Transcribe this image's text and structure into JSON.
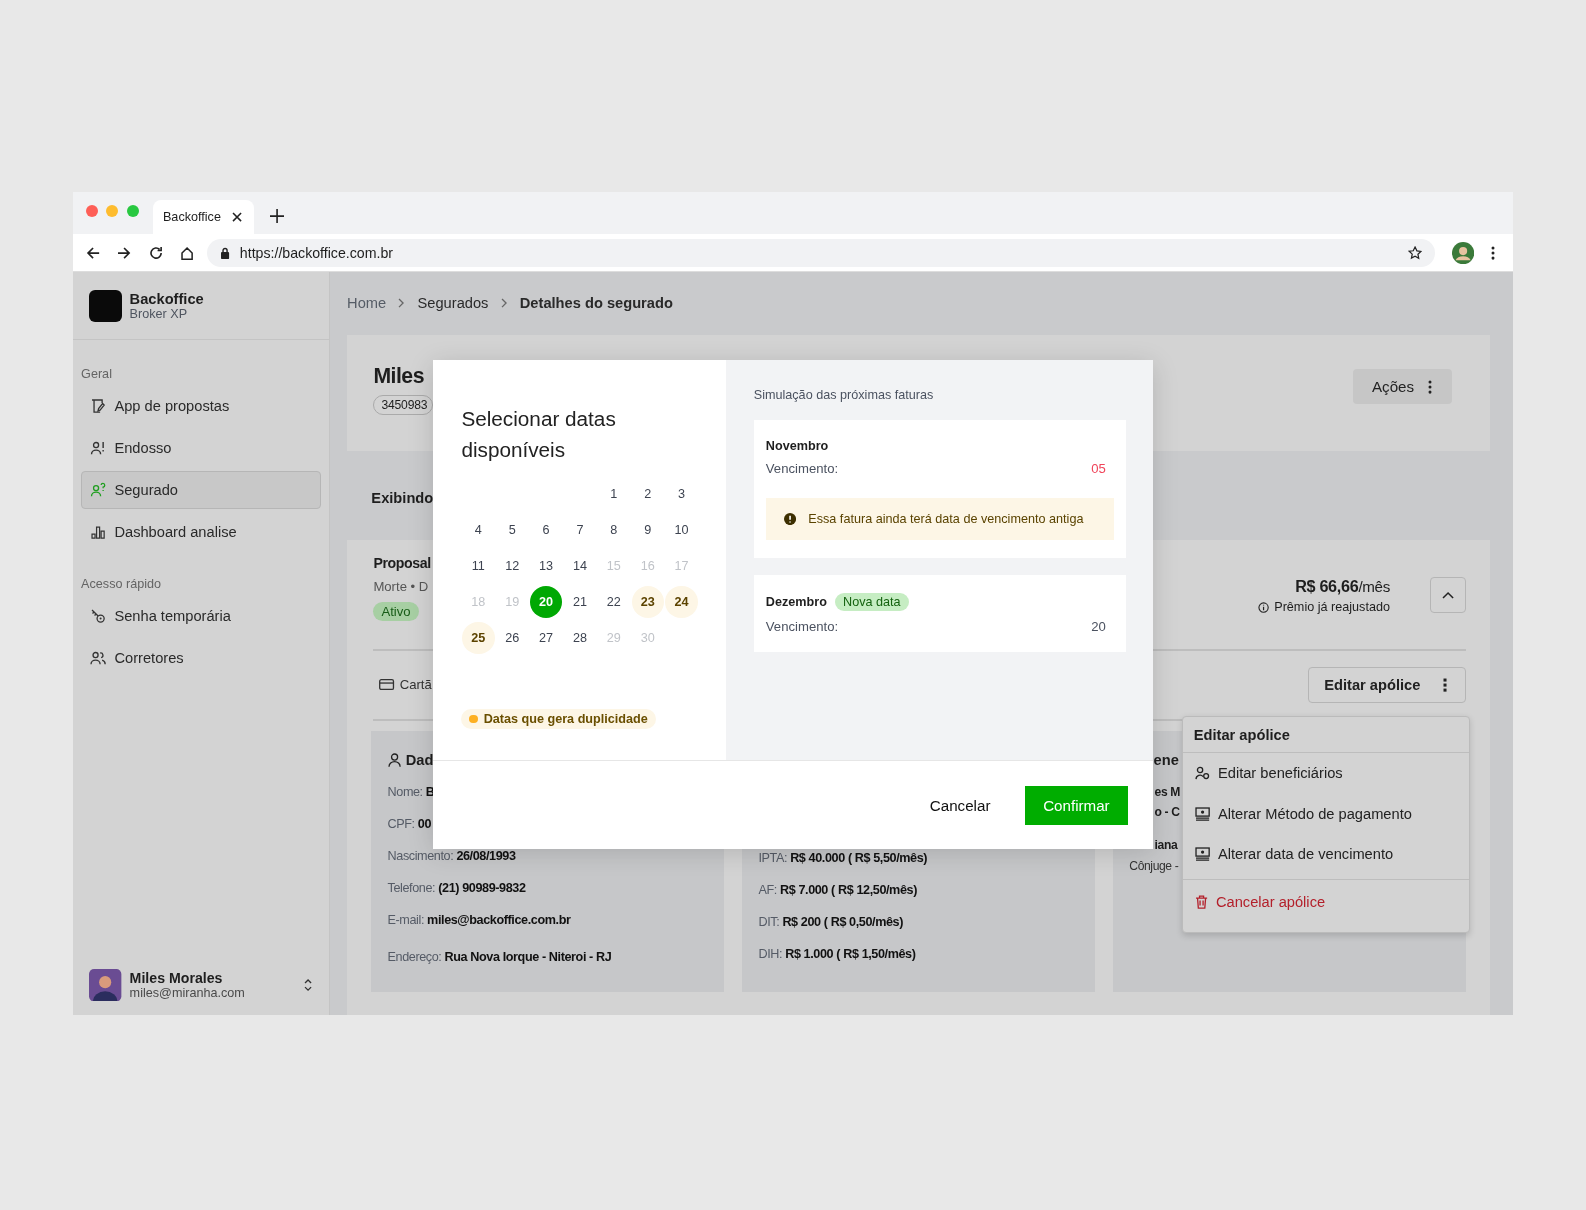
{
  "browser": {
    "tab_title": "Backoffice",
    "url": "https://backoffice.com.br"
  },
  "sidebar": {
    "brand": {
      "name": "Backoffice",
      "subtitle": "Broker XP"
    },
    "sections": [
      {
        "title": "Geral",
        "items": [
          {
            "label": "App de propostas",
            "selected": false
          },
          {
            "label": "Endosso",
            "selected": false
          },
          {
            "label": "Segurado",
            "selected": true
          },
          {
            "label": "Dashboard analise",
            "selected": false
          }
        ]
      },
      {
        "title": "Acesso rápido",
        "items": [
          {
            "label": "Senha temporária",
            "selected": false
          },
          {
            "label": "Corretores",
            "selected": false
          }
        ]
      }
    ],
    "user": {
      "name": "Miles Morales",
      "email": "miles@miranha.com"
    }
  },
  "breadcrumb": [
    {
      "label": "Home",
      "current": false
    },
    {
      "label": "Segurados",
      "current": false
    },
    {
      "label": "Detalhes do segurado",
      "current": true
    }
  ],
  "header": {
    "name": "Miles",
    "id_badge": "3450983",
    "actions_button": "Ações"
  },
  "showing_label": "Exibindo",
  "policy": {
    "title": "Proposal",
    "subtitle": "Morte • D",
    "status": "Ativo",
    "price": "R$ 66,66",
    "price_unit": "/mês",
    "price_note": "Prêmio já reajustado",
    "expanded": true,
    "payment": "Cartã",
    "edit_button": "Editar apólice"
  },
  "info_cards": [
    {
      "kind": "personal",
      "title": "Dad",
      "fields": [
        {
          "label": "Nome:",
          "value": "B"
        },
        {
          "label": "CPF:",
          "value": "00"
        },
        {
          "label": "Nascimento:",
          "value": "26/08/1993"
        },
        {
          "label": "Telefone:",
          "value": "(21) 90989-9832"
        },
        {
          "label": "E-mail:",
          "value": "miles@backoffice.com.br"
        },
        {
          "label": "Endereço:",
          "value": "Rua Nova Iorque - Niteroi - RJ"
        }
      ]
    },
    {
      "kind": "coverage",
      "fields": [
        {
          "label": "IPTA:",
          "value": "R$ 40.000 ( R$ 5,50/mês)"
        },
        {
          "label": "AF:",
          "value": "R$ 7.000 ( R$ 12,50/mês)"
        },
        {
          "label": "DIT:",
          "value": "R$ 200 ( R$ 0,50/mês)"
        },
        {
          "label": "DIH:",
          "value": "R$ 1.000 ( R$ 1,50/mês)"
        }
      ]
    },
    {
      "kind": "beneficiaries",
      "title": "ene",
      "lines": [
        {
          "kind": "name",
          "text": "es M"
        },
        {
          "kind": "name",
          "text": "o - C"
        },
        {
          "kind": "name",
          "text": "iana"
        },
        {
          "kind": "relation",
          "text": "Cônjuge -"
        }
      ]
    }
  ],
  "modal": {
    "title": "Selecionar datas disponíveis",
    "weeks": [
      [
        {
          "day": "1",
          "selected": false,
          "disabled": false,
          "duplicate": false
        },
        {
          "day": "2",
          "selected": false,
          "disabled": false,
          "duplicate": false
        },
        {
          "day": "3",
          "selected": false,
          "disabled": false,
          "duplicate": false
        }
      ],
      [
        {
          "day": "4",
          "selected": false,
          "disabled": false,
          "duplicate": false
        },
        {
          "day": "5",
          "selected": false,
          "disabled": false,
          "duplicate": false
        },
        {
          "day": "6",
          "selected": false,
          "disabled": false,
          "duplicate": false
        },
        {
          "day": "7",
          "selected": false,
          "disabled": false,
          "duplicate": false
        },
        {
          "day": "8",
          "selected": false,
          "disabled": false,
          "duplicate": false
        },
        {
          "day": "9",
          "selected": false,
          "disabled": false,
          "duplicate": false
        },
        {
          "day": "10",
          "selected": false,
          "disabled": false,
          "duplicate": false
        }
      ],
      [
        {
          "day": "11",
          "selected": false,
          "disabled": false,
          "duplicate": false
        },
        {
          "day": "12",
          "selected": false,
          "disabled": false,
          "duplicate": false
        },
        {
          "day": "13",
          "selected": false,
          "disabled": false,
          "duplicate": false
        },
        {
          "day": "14",
          "selected": false,
          "disabled": false,
          "duplicate": false
        },
        {
          "day": "15",
          "selected": false,
          "disabled": true,
          "duplicate": false
        },
        {
          "day": "16",
          "selected": false,
          "disabled": true,
          "duplicate": false
        },
        {
          "day": "17",
          "selected": false,
          "disabled": true,
          "duplicate": false
        }
      ],
      [
        {
          "day": "18",
          "selected": false,
          "disabled": true,
          "duplicate": false
        },
        {
          "day": "19",
          "selected": false,
          "disabled": true,
          "duplicate": false
        },
        {
          "day": "20",
          "selected": true,
          "disabled": false,
          "duplicate": false
        },
        {
          "day": "21",
          "selected": false,
          "disabled": false,
          "duplicate": false
        },
        {
          "day": "22",
          "selected": false,
          "disabled": false,
          "duplicate": false
        },
        {
          "day": "23",
          "selected": false,
          "disabled": false,
          "duplicate": true
        },
        {
          "day": "24",
          "selected": false,
          "disabled": false,
          "duplicate": true
        }
      ],
      [
        {
          "day": "25",
          "selected": false,
          "disabled": false,
          "duplicate": true
        },
        {
          "day": "26",
          "selected": false,
          "disabled": false,
          "duplicate": false
        },
        {
          "day": "27",
          "selected": false,
          "disabled": false,
          "duplicate": false
        },
        {
          "day": "28",
          "selected": false,
          "disabled": false,
          "duplicate": false
        },
        {
          "day": "29",
          "selected": false,
          "disabled": true,
          "duplicate": false
        },
        {
          "day": "30",
          "selected": false,
          "disabled": true,
          "duplicate": false
        }
      ]
    ],
    "legend": "Datas que gera duplicidade",
    "simulation_title": "Simulação das próximas faturas",
    "invoices": [
      {
        "month": "Novembro",
        "due_label": "Vencimento:",
        "due_value": "05",
        "outdated": true,
        "warning": "Essa fatura ainda terá data de vencimento antiga"
      },
      {
        "month": "Dezembro",
        "badge": "Nova data",
        "due_label": "Vencimento:",
        "due_value": "20",
        "outdated": false
      }
    ],
    "cancel_button": "Cancelar",
    "confirm_button": "Confirmar"
  },
  "menu": {
    "title": "Editar apólice",
    "items": [
      {
        "label": "Editar beneficiários",
        "kind": "normal"
      },
      {
        "label": "Alterar Método de pagamento",
        "kind": "normal"
      },
      {
        "label": "Alterar data de vencimento",
        "kind": "normal"
      },
      {
        "label": "Cancelar apólice",
        "kind": "danger"
      }
    ]
  }
}
